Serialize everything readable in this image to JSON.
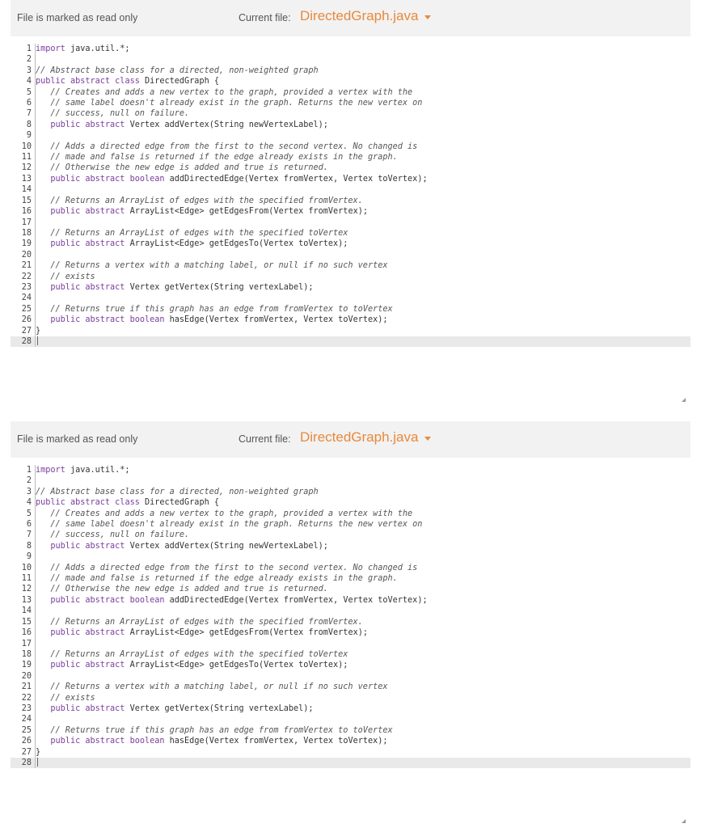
{
  "panels": [
    {
      "readonly_text": "File is marked as read only",
      "current_file_label": "Current file:",
      "current_file_name": "DirectedGraph.java",
      "current_line": 28
    },
    {
      "readonly_text": "File is marked as read only",
      "current_file_label": "Current file:",
      "current_file_name": "DirectedGraph.java",
      "current_line": 28
    }
  ],
  "code_lines": [
    {
      "n": "1",
      "text": "import java.util.*;"
    },
    {
      "n": "2",
      "text": ""
    },
    {
      "n": "3",
      "text": "// Abstract base class for a directed, non-weighted graph"
    },
    {
      "n": "4",
      "text": "public abstract class DirectedGraph {"
    },
    {
      "n": "5",
      "text": "   // Creates and adds a new vertex to the graph, provided a vertex with the"
    },
    {
      "n": "6",
      "text": "   // same label doesn't already exist in the graph. Returns the new vertex on"
    },
    {
      "n": "7",
      "text": "   // success, null on failure."
    },
    {
      "n": "8",
      "text": "   public abstract Vertex addVertex(String newVertexLabel);"
    },
    {
      "n": "9",
      "text": ""
    },
    {
      "n": "10",
      "text": "   // Adds a directed edge from the first to the second vertex. No changed is"
    },
    {
      "n": "11",
      "text": "   // made and false is returned if the edge already exists in the graph."
    },
    {
      "n": "12",
      "text": "   // Otherwise the new edge is added and true is returned."
    },
    {
      "n": "13",
      "text": "   public abstract boolean addDirectedEdge(Vertex fromVertex, Vertex toVertex);"
    },
    {
      "n": "14",
      "text": ""
    },
    {
      "n": "15",
      "text": "   // Returns an ArrayList of edges with the specified fromVertex."
    },
    {
      "n": "16",
      "text": "   public abstract ArrayList<Edge> getEdgesFrom(Vertex fromVertex);"
    },
    {
      "n": "17",
      "text": ""
    },
    {
      "n": "18",
      "text": "   // Returns an ArrayList of edges with the specified toVertex"
    },
    {
      "n": "19",
      "text": "   public abstract ArrayList<Edge> getEdgesTo(Vertex toVertex);"
    },
    {
      "n": "20",
      "text": ""
    },
    {
      "n": "21",
      "text": "   // Returns a vertex with a matching label, or null if no such vertex"
    },
    {
      "n": "22",
      "text": "   // exists"
    },
    {
      "n": "23",
      "text": "   public abstract Vertex getVertex(String vertexLabel);"
    },
    {
      "n": "24",
      "text": ""
    },
    {
      "n": "25",
      "text": "   // Returns true if this graph has an edge from fromVertex to toVertex"
    },
    {
      "n": "26",
      "text": "   public abstract boolean hasEdge(Vertex fromVertex, Vertex toVertex);"
    },
    {
      "n": "27",
      "text": "}"
    },
    {
      "n": "28",
      "text": ""
    }
  ],
  "colors": {
    "accent": "#e8893b",
    "header_bg": "#f2f2f2",
    "keyword": "#7a3e9d",
    "comment": "#555555"
  },
  "icons": {
    "dropdown": "caret-down-icon",
    "resize": "resize-handle-icon"
  }
}
